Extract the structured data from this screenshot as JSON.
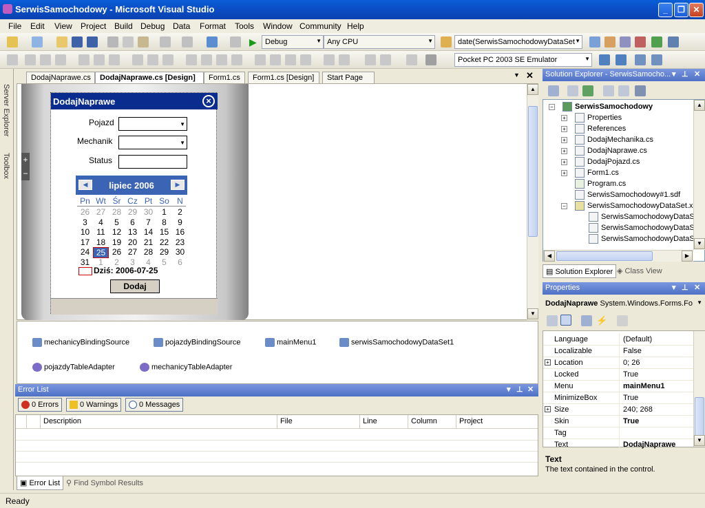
{
  "window": {
    "title": "SerwisSamochodowy - Microsoft Visual Studio",
    "min": "_",
    "max": "❐",
    "close": "✕"
  },
  "menu": [
    "File",
    "Edit",
    "View",
    "Project",
    "Build",
    "Debug",
    "Data",
    "Format",
    "Tools",
    "Window",
    "Community",
    "Help"
  ],
  "toolbar": {
    "config": "Debug",
    "platform": "Any CPU",
    "target_object": "date(SerwisSamochodowyDataSet",
    "device": "Pocket PC 2003 SE Emulator"
  },
  "side": {
    "server_explorer": "Server Explorer",
    "toolbox": "Toolbox"
  },
  "doc_tabs": [
    "DodajNaprawe.cs",
    "DodajNaprawe.cs [Design]",
    "Form1.cs",
    "Form1.cs [Design]",
    "Start Page"
  ],
  "form": {
    "title": "DodajNaprawe",
    "labels": {
      "pojazd": "Pojazd",
      "mechanik": "Mechanik",
      "status": "Status"
    },
    "calendar": {
      "month": "lipiec 2006",
      "day_headers": [
        "Pn",
        "Wt",
        "Śr",
        "Cz",
        "Pt",
        "So",
        "N"
      ],
      "weeks": [
        [
          "26",
          "27",
          "28",
          "29",
          "30",
          "1",
          "2"
        ],
        [
          "3",
          "4",
          "5",
          "6",
          "7",
          "8",
          "9"
        ],
        [
          "10",
          "11",
          "12",
          "13",
          "14",
          "15",
          "16"
        ],
        [
          "17",
          "18",
          "19",
          "20",
          "21",
          "22",
          "23"
        ],
        [
          "24",
          "25",
          "26",
          "27",
          "28",
          "29",
          "30"
        ],
        [
          "31",
          "1",
          "2",
          "3",
          "4",
          "5",
          "6"
        ]
      ],
      "today": "Dziś: 2006-07-25"
    },
    "add_button": "Dodaj"
  },
  "components": [
    "mechanicyBindingSource",
    "pojazdyBindingSource",
    "mainMenu1",
    "serwisSamochodowyDataSet1",
    "pojazdyTableAdapter",
    "mechanicyTableAdapter"
  ],
  "error_list": {
    "title": "Error List",
    "errors": "0 Errors",
    "warnings": "0 Warnings",
    "messages": "0 Messages",
    "columns": [
      "Description",
      "File",
      "Line",
      "Column",
      "Project"
    ]
  },
  "bottom_tabs": [
    "Error List",
    "Find Symbol Results"
  ],
  "status": "Ready",
  "solution_explorer": {
    "title": "Solution Explorer - SerwisSamocho...",
    "root": "SerwisSamochodowy",
    "items": [
      "Properties",
      "References",
      "DodajMechanika.cs",
      "DodajNaprawe.cs",
      "DodajPojazd.cs",
      "Form1.cs",
      "Program.cs",
      "SerwisSamochodowy#1.sdf",
      "SerwisSamochodowyDataSet.x",
      "SerwisSamochodowyDataSe",
      "SerwisSamochodowyDataSe",
      "SerwisSamochodowyDataSe"
    ],
    "tabs": [
      "Solution Explorer",
      "Class View"
    ]
  },
  "properties": {
    "title": "Properties",
    "object": "DodajNaprawe",
    "object_type": "System.Windows.Forms.Fo",
    "rows": [
      {
        "name": "Language",
        "value": "(Default)"
      },
      {
        "name": "Localizable",
        "value": "False"
      },
      {
        "name": "Location",
        "value": "0; 26"
      },
      {
        "name": "Locked",
        "value": "True"
      },
      {
        "name": "Menu",
        "value": "mainMenu1"
      },
      {
        "name": "MinimizeBox",
        "value": "True"
      },
      {
        "name": "Size",
        "value": "240; 268"
      },
      {
        "name": "Skin",
        "value": "True"
      },
      {
        "name": "Tag",
        "value": ""
      },
      {
        "name": "Text",
        "value": "DodajNaprawe"
      }
    ],
    "desc_title": "Text",
    "desc": "The text contained in the control."
  }
}
